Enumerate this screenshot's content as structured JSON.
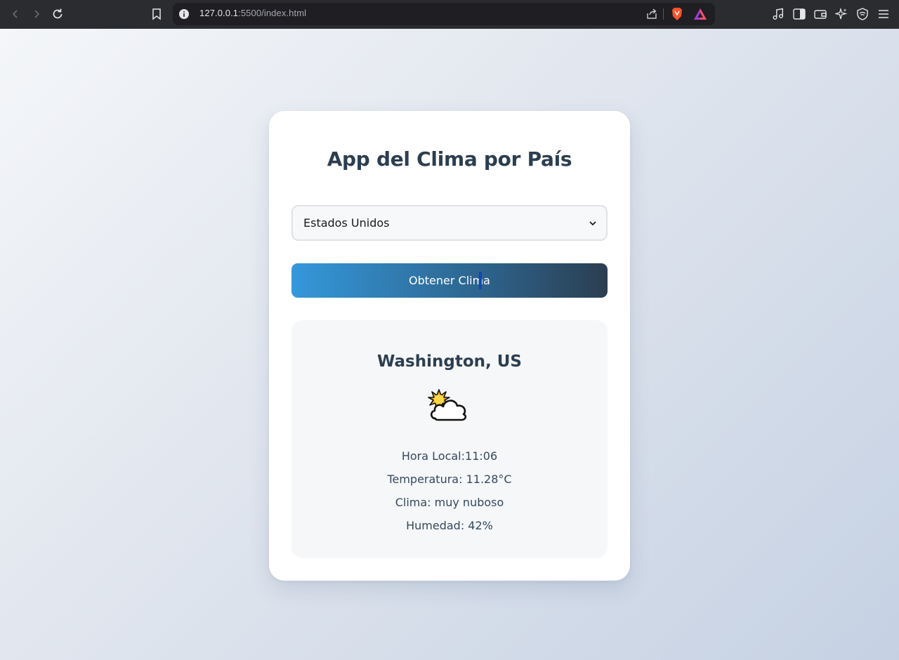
{
  "browser": {
    "url_host": "127.0.0.1",
    "url_rest": ":5500/index.html"
  },
  "app": {
    "title": "App del Clima por País",
    "country_select": {
      "selected": "Estados Unidos"
    },
    "get_weather_button": "Obtener Clima",
    "result": {
      "city": "Washington, US",
      "weather_icon": "sun-behind-cloud-icon",
      "local_time": "Hora Local:11:06",
      "temperature": "Temperatura: 11.28°C",
      "condition": "Clima: muy nuboso",
      "humidity": "Humedad: 42%"
    }
  },
  "colors": {
    "title": "#2c3e50",
    "button_start": "#3498db",
    "button_end": "#2c3e50",
    "card_bg": "#ffffff",
    "result_bg": "#f6f7f9"
  }
}
